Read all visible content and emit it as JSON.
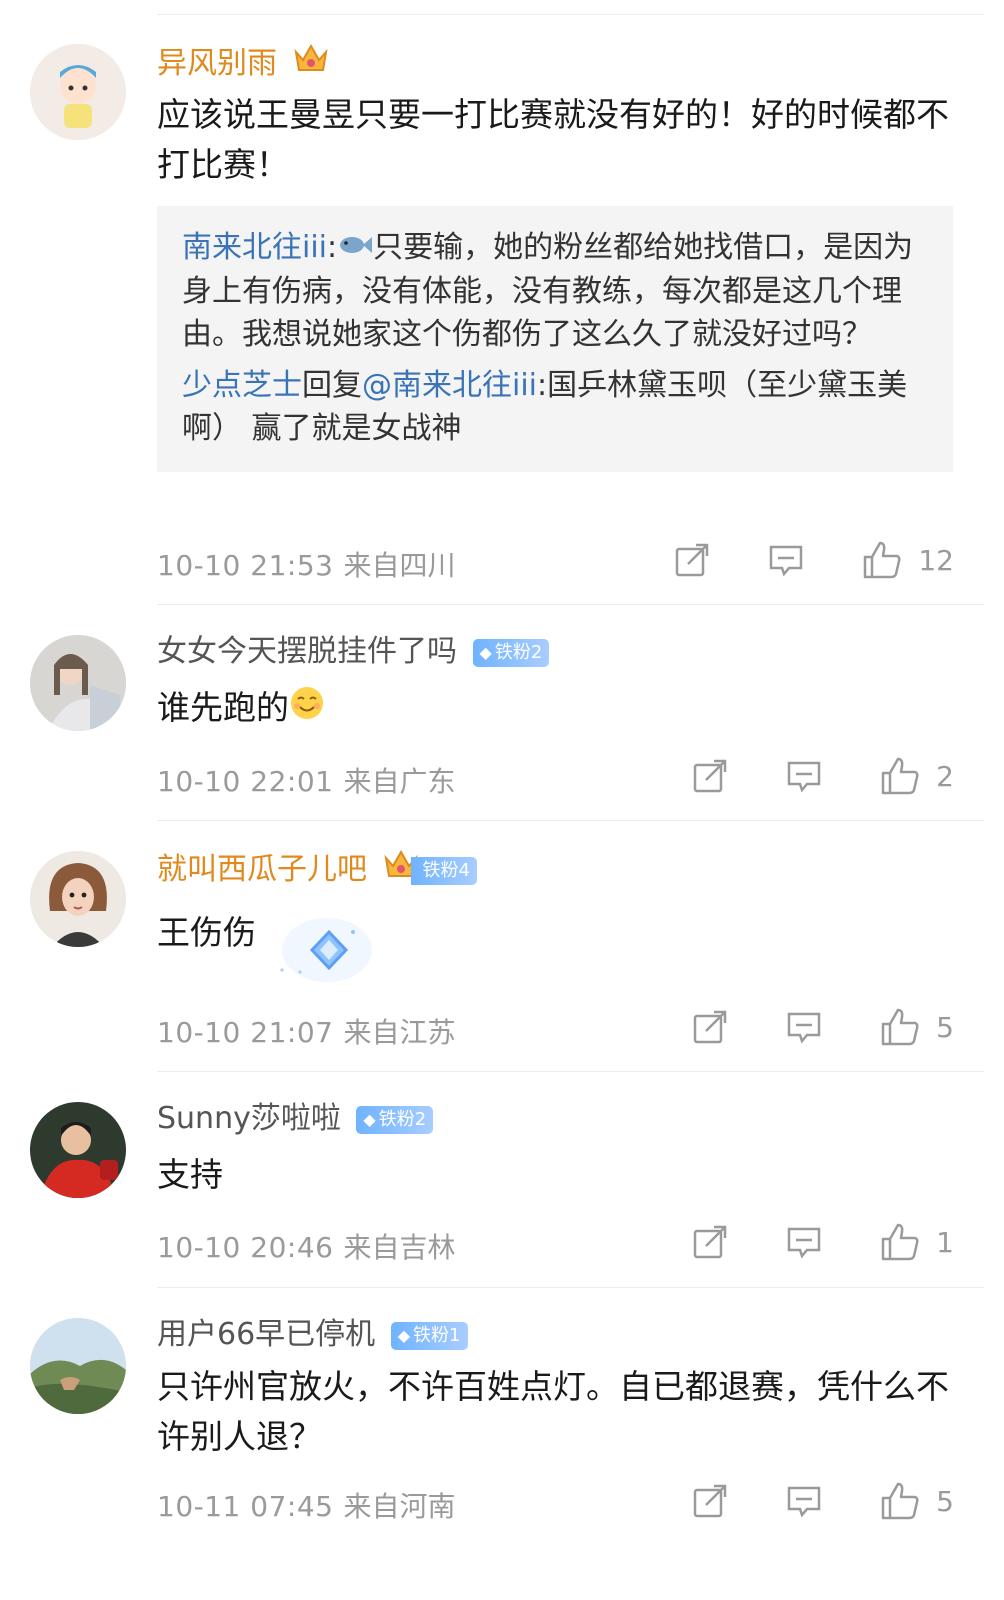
{
  "comments": [
    {
      "user": "异风别雨",
      "user_color": "#e08a1e",
      "vip_crown": true,
      "badge": "",
      "text": "应该说王曼昱只要一打比赛就没有好的！好的时候都不打比赛！",
      "quote": {
        "author": "南来北往iii",
        "sep": ":",
        "emoji": "fish-icon",
        "body": "只要输，她的粉丝都给她找借口，是因为身上有伤病，没有体能，没有教练，每次都是这几个理由。我想说她家这个伤都伤了这么久了就没好过吗？",
        "reply_user": "少点芝士",
        "reply_word": "回复",
        "reply_target": "@南来北往iii",
        "reply_body": ":国乒林黛玉呗（至少黛玉美啊） 赢了就是女战神"
      },
      "time": "10-10 21:53",
      "location": "来自四川",
      "likes": "12"
    },
    {
      "user": "女女今天摆脱挂件了吗",
      "user_color": "#555555",
      "badge": "铁粉2",
      "text": "谁先跑的",
      "emoji": "smiling-face-icon",
      "time": "10-10 22:01",
      "location": "来自广东",
      "likes": "2"
    },
    {
      "user": "就叫西瓜子儿吧",
      "user_color": "#e08a1e",
      "vip_crown": true,
      "badge": "铁粉4",
      "text": "王伤伤",
      "time": "10-10 21:07",
      "location": "来自江苏",
      "likes": "5"
    },
    {
      "user": "Sunny莎啦啦",
      "user_color": "#555555",
      "badge": "铁粉2",
      "text": "支持",
      "time": "10-10 20:46",
      "location": "来自吉林",
      "likes": "1"
    },
    {
      "user": "用户66早已停机",
      "user_color": "#555555",
      "badge": "铁粉1",
      "text": "只许州官放火，不许百姓点灯。自已都退赛，凭什么不许别人退？",
      "time": "10-11 07:45",
      "location": "来自河南",
      "likes": "5"
    }
  ],
  "colors": {
    "link": "#3a74b6",
    "meta": "#9a9a9a",
    "badge": "#6fb3ff"
  }
}
